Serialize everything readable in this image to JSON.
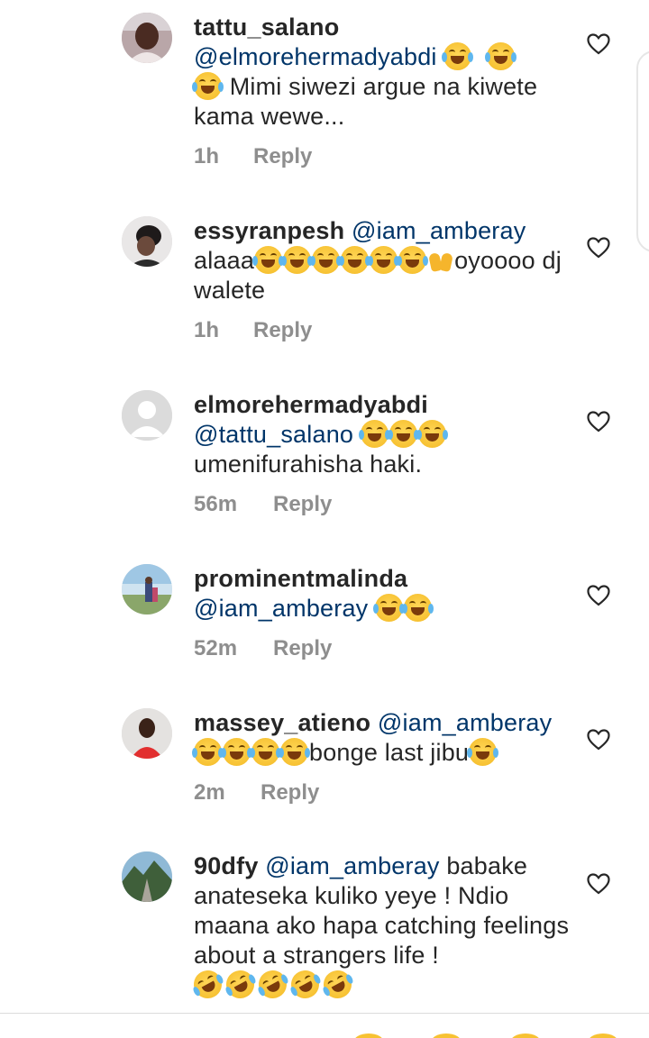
{
  "comments": [
    {
      "username": "tattu_salano",
      "mention": "@elmorehermadyabdi",
      "text": "Mimi siwezi argue na kiwete kama wewe...",
      "time": "1h",
      "reply_label": "Reply",
      "emojis": [
        "face-with-tears-of-joy",
        "face-with-tears-of-joy",
        "face-with-tears-of-joy"
      ]
    },
    {
      "username": "essyranpesh",
      "mention": "@iam_amberay",
      "text_start": "alaaa",
      "text_end": "oyoooo dj walete",
      "time": "1h",
      "reply_label": "Reply",
      "emojis": [
        "face-with-tears-of-joy",
        "face-with-tears-of-joy",
        "face-with-tears-of-joy",
        "face-with-tears-of-joy",
        "face-with-tears-of-joy",
        "face-with-tears-of-joy",
        "raising-hands"
      ]
    },
    {
      "username": "elmorehermadyabdi",
      "mention": "@tattu_salano",
      "text": "umenifurahisha haki.",
      "time": "56m",
      "reply_label": "Reply",
      "emojis": [
        "face-with-tears-of-joy",
        "face-with-tears-of-joy",
        "face-with-tears-of-joy"
      ]
    },
    {
      "username": "prominentmalinda",
      "mention": "@iam_amberay",
      "time": "52m",
      "reply_label": "Reply",
      "emojis": [
        "face-with-tears-of-joy",
        "face-with-tears-of-joy"
      ]
    },
    {
      "username": "massey_atieno",
      "mention": "@iam_amberay",
      "text": "bonge last jibu",
      "time": "2m",
      "reply_label": "Reply",
      "emojis": [
        "face-with-tears-of-joy",
        "face-with-tears-of-joy",
        "face-with-tears-of-joy",
        "face-with-tears-of-joy",
        "face-with-tears-of-joy"
      ]
    },
    {
      "username": "90dfy",
      "mention": "@iam_amberay",
      "text": "babake anateseka kuliko yeye ! Ndio maana ako hapa catching feelings about a strangers life !",
      "emojis": [
        "rolling-on-the-floor-laughing",
        "rolling-on-the-floor-laughing",
        "rolling-on-the-floor-laughing",
        "rolling-on-the-floor-laughing",
        "rolling-on-the-floor-laughing"
      ]
    }
  ],
  "icons": {
    "like": "heart-outline-icon",
    "avatar_default": "default-avatar-icon"
  },
  "colors": {
    "username": "#262626",
    "mention": "#003569",
    "meta": "#8e8e8e"
  }
}
